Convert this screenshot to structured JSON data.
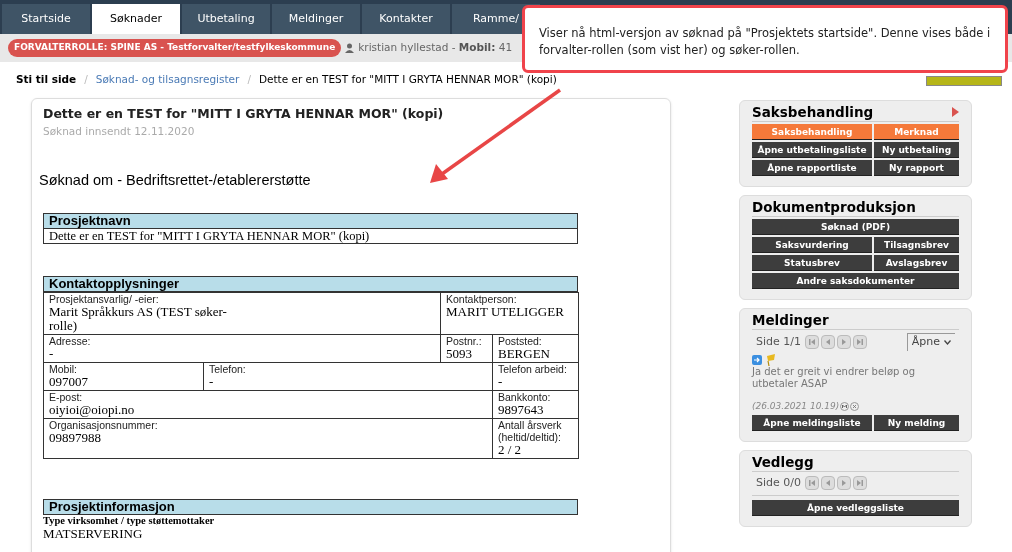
{
  "tabs": [
    {
      "label": "Startside",
      "selected": false
    },
    {
      "label": "Søknader",
      "selected": true
    },
    {
      "label": "Utbetaling",
      "selected": false
    },
    {
      "label": "Meldinger",
      "selected": false
    },
    {
      "label": "Kontakter",
      "selected": false
    },
    {
      "label": "Ramme/",
      "selected": false
    }
  ],
  "role_badge": "FORVALTERROLLE: SPINE AS - Testforvalter/testfylkeskommune",
  "user": {
    "name": "kristian hyllestad - ",
    "mobile_label": "Mobil:",
    "mobile": "41"
  },
  "breadcrumb": {
    "label": "Sti til side",
    "separator": "/",
    "links": [
      "Søknad- og tilsagnsregister"
    ],
    "current": "Dette er en TEST for \"MITT I GRYTA HENNAR MOR\" (kopi)"
  },
  "callout": "Viser nå html-versjon av søknad på \"Prosjektets startside\". Denne vises både i forvalter-rollen (som vist her) og søker-rollen.",
  "document": {
    "title": "Dette er en TEST for \"MITT I GRYTA HENNAR MOR\" (kopi)",
    "submitted": "Søknad innsendt 12.11.2020",
    "heading": "Søknad om - Bedriftsrettet-/etablererstøtte",
    "project_name": {
      "title": "Prosjektnavn",
      "value": "Dette er en TEST for \"MITT I GRYTA HENNAR MOR\" (kopi)"
    },
    "contact": {
      "title": "Kontaktopplysninger",
      "rows": [
        [
          {
            "label": "Prosjektansvarlig/ -eier:",
            "value": "Marit Språkkurs AS (TEST søker-rolle)",
            "colspan": 2
          },
          {
            "label": "Kontaktperson:",
            "value": "MARIT UTELIGGER",
            "colspan": 2
          }
        ],
        [
          {
            "label": "Adresse:",
            "value": "-",
            "colspan": 2
          },
          {
            "label": "Postnr.:",
            "value": "5093"
          },
          {
            "label": "Poststed:",
            "value": "BERGEN"
          }
        ],
        [
          {
            "label": "Mobil:",
            "value": "097007"
          },
          {
            "label": "Telefon:",
            "value": "-",
            "colspan": 2
          },
          {
            "label": "Telefon arbeid:",
            "value": "-"
          }
        ],
        [
          {
            "label": "E-post:",
            "value": "oiyioi@oiopi.no",
            "colspan": 3
          },
          {
            "label": "Bankkonto:",
            "value": "9897643"
          }
        ],
        [
          {
            "label": "Organisasjonsnummer:",
            "value": "09897988",
            "colspan": 3
          },
          {
            "label": "Antall årsverk (heltid/deltid):",
            "value": "2 / 2"
          }
        ]
      ]
    },
    "project_info": {
      "title": "Prosjektinformasjon",
      "label": "Type virksomhet / type støttemottaker",
      "value": "MATSERVERING"
    }
  },
  "panels": [
    {
      "title": "Saksbehandling",
      "has_arrow": true,
      "buttons": [
        {
          "label": "Saksbehandling",
          "kind": "accent",
          "wide": false
        },
        {
          "label": "Merknad",
          "kind": "accent",
          "wide": false
        },
        {
          "label": "Åpne utbetalingsliste",
          "kind": "dark",
          "wide": false
        },
        {
          "label": "Ny utbetaling",
          "kind": "dark",
          "wide": false
        },
        {
          "label": "Åpne rapportliste",
          "kind": "dark",
          "wide": false
        },
        {
          "label": "Ny rapport",
          "kind": "dark",
          "wide": false
        }
      ]
    },
    {
      "title": "Dokumentproduksjon",
      "has_arrow": false,
      "buttons": [
        {
          "label": "Søknad (PDF)",
          "kind": "dark",
          "wide": true
        },
        {
          "label": "Saksvurdering",
          "kind": "dark",
          "wide": false
        },
        {
          "label": "Tilsagnsbrev",
          "kind": "dark",
          "wide": false
        },
        {
          "label": "Statusbrev",
          "kind": "dark",
          "wide": false
        },
        {
          "label": "Avslagsbrev",
          "kind": "dark",
          "wide": false
        },
        {
          "label": "Andre saksdokumenter",
          "kind": "dark",
          "wide": true
        }
      ]
    },
    {
      "title": "Meldinger",
      "has_arrow": false,
      "pager": "Side 1/1",
      "select": "Åpne",
      "message": {
        "text": "Ja det er greit vi endrer beløp og utbetaler ASAP",
        "date": "(26.03.2021 10.19)"
      },
      "buttons": [
        {
          "label": "Åpne meldingsliste",
          "kind": "dark",
          "wide": false
        },
        {
          "label": "Ny melding",
          "kind": "dark",
          "wide": false
        }
      ]
    },
    {
      "title": "Vedlegg",
      "has_arrow": false,
      "pager": "Side 0/0",
      "buttons": [
        {
          "label": "Åpne vedleggsliste",
          "kind": "dark",
          "wide": true
        }
      ]
    }
  ]
}
